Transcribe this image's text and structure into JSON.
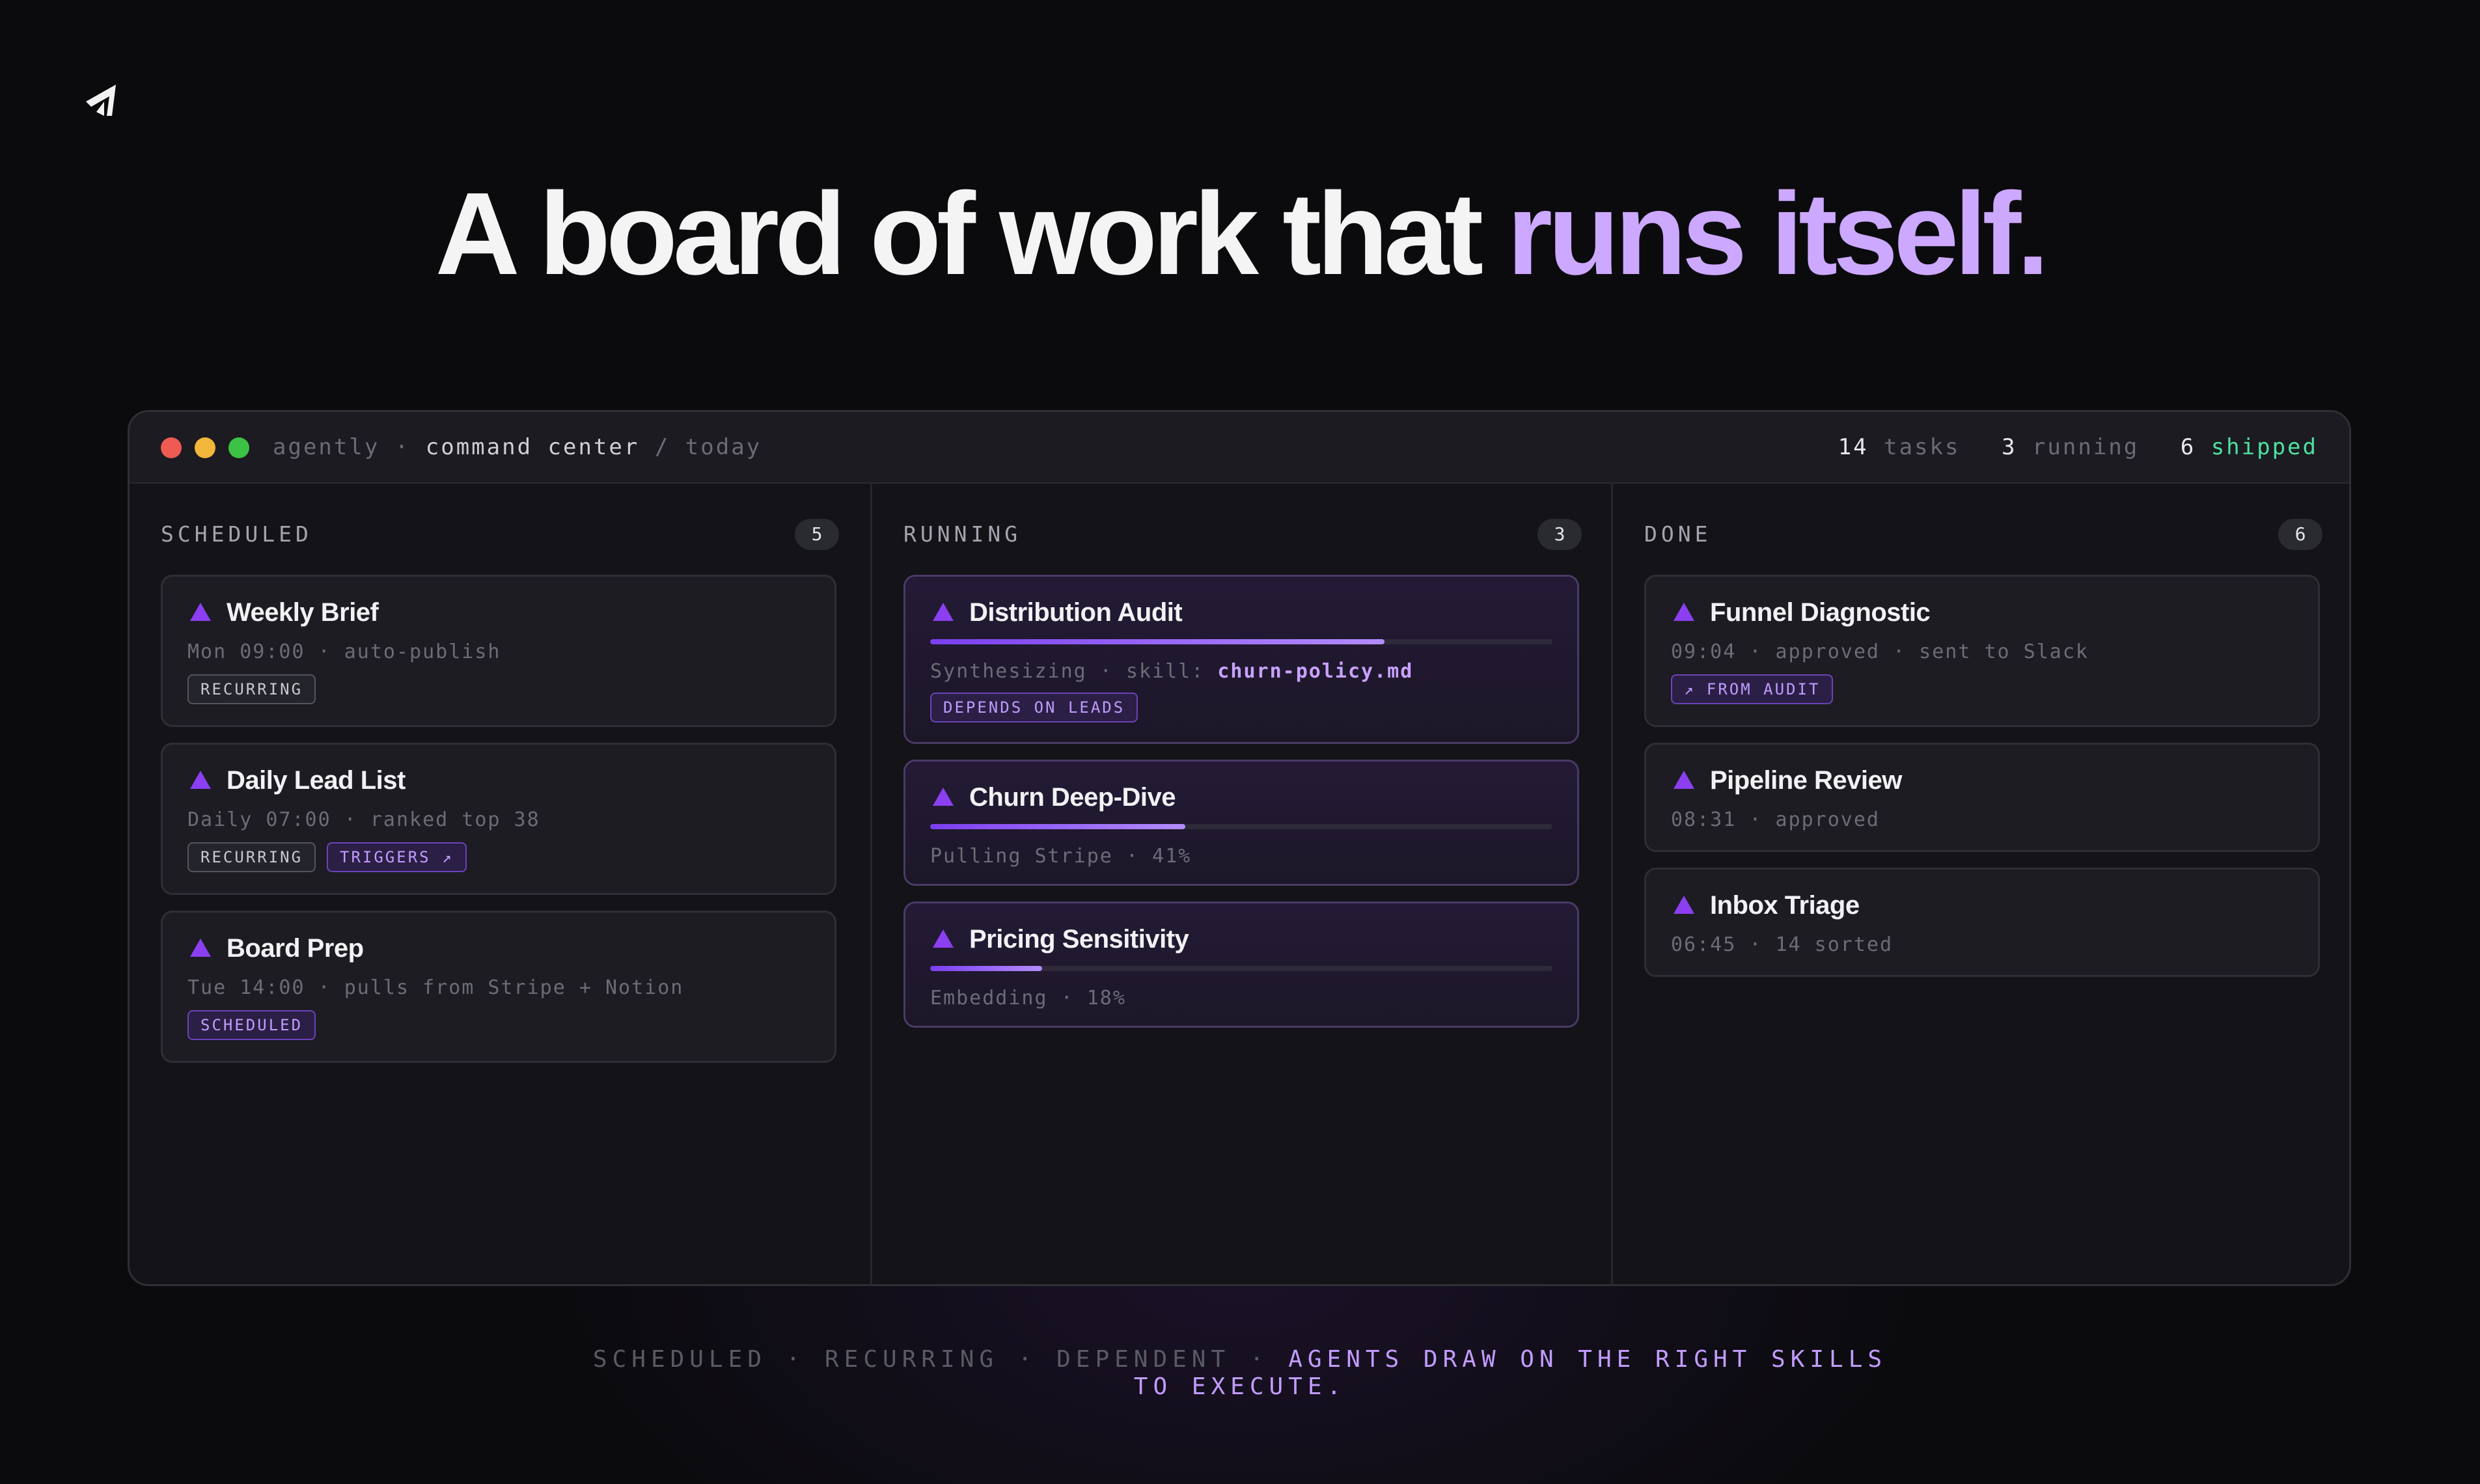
{
  "headline": {
    "part1": "A board of work that ",
    "part2": "runs itself."
  },
  "window": {
    "crumb_app": "agently",
    "crumb_sep": "·",
    "crumb_page": "command center",
    "crumb_slash": "/",
    "crumb_view": "today",
    "stats": {
      "tasks_count": "14",
      "tasks_label": "tasks",
      "running_count": "3",
      "running_label": "running",
      "shipped_count": "6",
      "shipped_label": "shipped"
    }
  },
  "columns": [
    {
      "title": "SCHEDULED",
      "count": "5",
      "cards": [
        {
          "title": "Weekly Brief",
          "meta": "Mon 09:00 · auto-publish",
          "tags": [
            "RECURRING"
          ]
        },
        {
          "title": "Daily Lead List",
          "meta": "Daily 07:00 · ranked top 38",
          "tags": [
            "RECURRING",
            "TRIGGERS ↗"
          ]
        },
        {
          "title": "Board Prep",
          "meta": "Tue 14:00 · pulls from Stripe + Notion",
          "tags": [
            "SCHEDULED"
          ]
        }
      ]
    },
    {
      "title": "RUNNING",
      "count": "3",
      "cards": [
        {
          "title": "Distribution Audit",
          "meta_prefix": "Synthesizing · skill: ",
          "meta_highlight": "churn-policy.md",
          "progress": 0.73,
          "tags": [
            "DEPENDS ON LEADS"
          ]
        },
        {
          "title": "Churn Deep-Dive",
          "meta": "Pulling Stripe · 41%",
          "progress": 0.41
        },
        {
          "title": "Pricing Sensitivity",
          "meta": "Embedding · 18%",
          "progress": 0.18
        }
      ]
    },
    {
      "title": "DONE",
      "count": "6",
      "cards": [
        {
          "title": "Funnel Diagnostic",
          "meta": "09:04 · approved · sent to Slack",
          "tags": [
            "↗ FROM AUDIT"
          ]
        },
        {
          "title": "Pipeline Review",
          "meta": "08:31 · approved"
        },
        {
          "title": "Inbox Triage",
          "meta": "06:45 · 14 sorted"
        }
      ]
    }
  ],
  "footer": {
    "muted": "SCHEDULED · RECURRING · DEPENDENT · ",
    "accent_line1": "AGENTS DRAW ON THE RIGHT SKILLS",
    "accent_line2": "TO EXECUTE."
  },
  "colors": {
    "accent": "#cda8ff",
    "triangle": "#8b3ff0",
    "shipped": "#4fe0a0",
    "background": "#0b0b0e"
  },
  "icons": {
    "logo": "agently-logo-icon",
    "card_marker": "triangle-icon"
  }
}
